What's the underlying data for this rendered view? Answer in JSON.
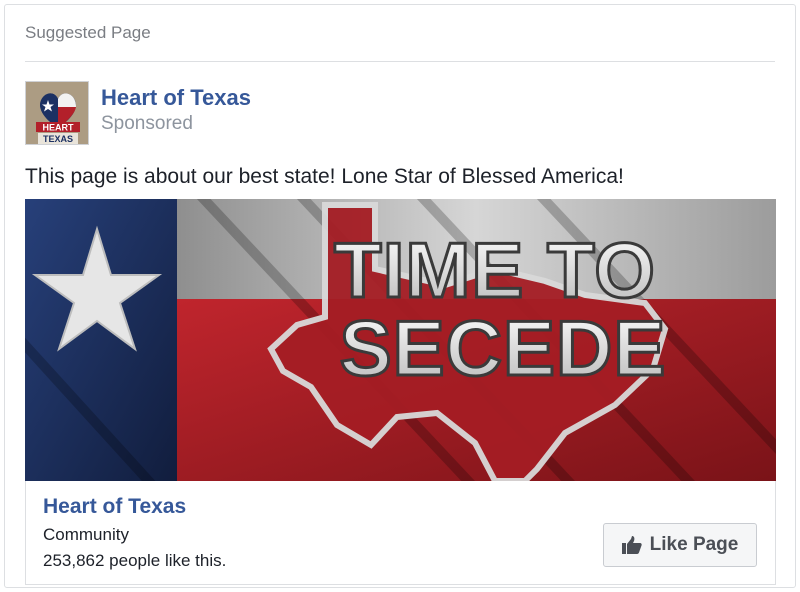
{
  "card": {
    "header_label": "Suggested Page"
  },
  "post": {
    "page_name": "Heart of Texas",
    "sponsored_label": "Sponsored",
    "text": "This page is about our best state! Lone Star of Blessed America!",
    "avatar": {
      "line1": "HEART",
      "line2": "TEXAS"
    }
  },
  "ad_image": {
    "headline_line1": "TIME TO",
    "headline_line2": "SECEDE",
    "colors": {
      "blue": "#1c3163",
      "red": "#a31e25",
      "white": "#e8e8e8"
    }
  },
  "footer": {
    "page_name": "Heart of Texas",
    "category": "Community",
    "likes_text": "253,862 people like this.",
    "like_button_label": "Like Page",
    "like_icon": "thumbs-up-icon"
  },
  "colors": {
    "link": "#365899",
    "muted": "#8d949e",
    "border": "#dddfe2"
  }
}
